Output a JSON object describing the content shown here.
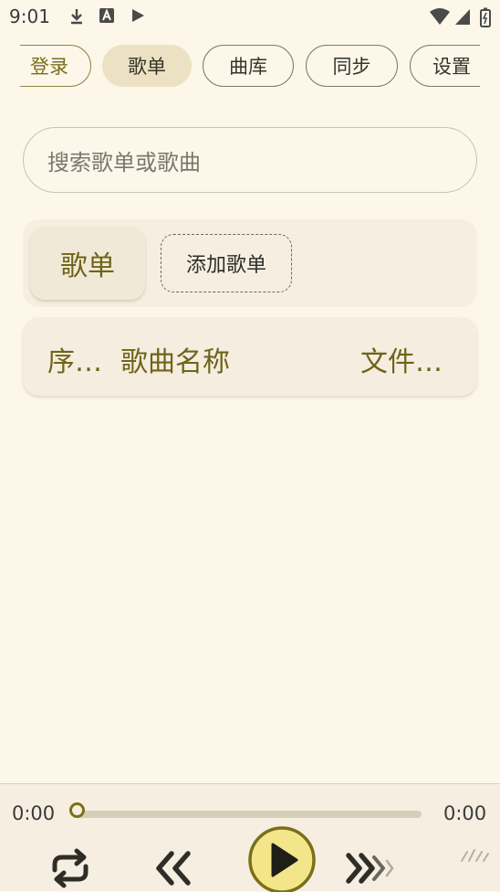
{
  "status_bar": {
    "time": "9:01"
  },
  "tabs": [
    {
      "label": "登录"
    },
    {
      "label": "歌单"
    },
    {
      "label": "曲库"
    },
    {
      "label": "同步"
    },
    {
      "label": "设置"
    }
  ],
  "active_tab": "歌单",
  "search": {
    "placeholder": "搜索歌单或歌曲"
  },
  "playlist_bar": {
    "playlist_chip": "歌单",
    "add_button": "添加歌单"
  },
  "list_header": {
    "index": "序…",
    "song_name": "歌曲名称",
    "file": "文件…"
  },
  "player": {
    "current_time": "0:00",
    "total_time": "0:00",
    "progress": 0
  },
  "colors": {
    "background": "#fdf7ea",
    "accent": "#7b7019",
    "chip": "#ece2c3",
    "play_button": "#f3e68a"
  },
  "icons": [
    "download-icon",
    "font-icon",
    "play-store-icon",
    "wifi-icon",
    "signal-icon",
    "battery-icon",
    "repeat-icon",
    "rewind-icon",
    "play-icon",
    "fast-forward-icon",
    "more-icon"
  ]
}
